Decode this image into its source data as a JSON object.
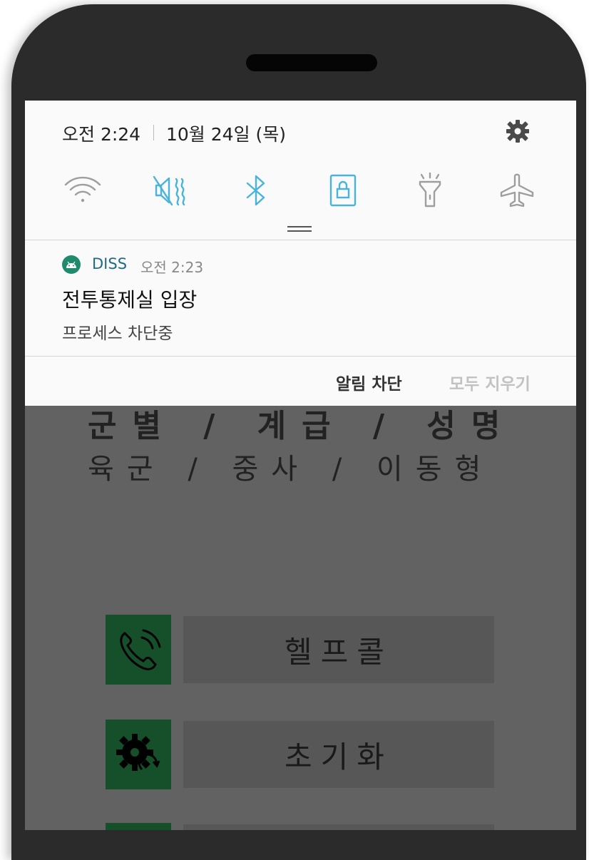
{
  "status": {
    "time": "오전 2:24",
    "date": "10월 24일 (목)"
  },
  "quick_settings": [
    {
      "name": "wifi-icon",
      "color": "#9e9e9e"
    },
    {
      "name": "mute-icon",
      "color": "#4ab3db"
    },
    {
      "name": "bluetooth-icon",
      "color": "#4ab3db"
    },
    {
      "name": "screen-lock-icon",
      "color": "#4ab3db"
    },
    {
      "name": "flashlight-icon",
      "color": "#9e9e9e"
    },
    {
      "name": "airplane-icon",
      "color": "#9e9e9e"
    }
  ],
  "notification": {
    "app_name": "DISS",
    "time": "오전 2:23",
    "title": "전투통제실 입장",
    "text": "프로세스 차단중",
    "actions": {
      "block": "알림 차단",
      "clear_all": "모두 지우기"
    }
  },
  "app": {
    "header": "군별 / 계급 / 성명",
    "value": "육군 / 중사 / 이동형",
    "menu": [
      {
        "label": "헬프콜",
        "icon": "phone-call-icon"
      },
      {
        "label": "초기화",
        "icon": "gear-reset-icon"
      }
    ]
  },
  "colors": {
    "accent": "#4ab3db",
    "app_icon": "#1f8a6c",
    "menu_icon_bg": "#15502a",
    "dim": "#626262"
  }
}
